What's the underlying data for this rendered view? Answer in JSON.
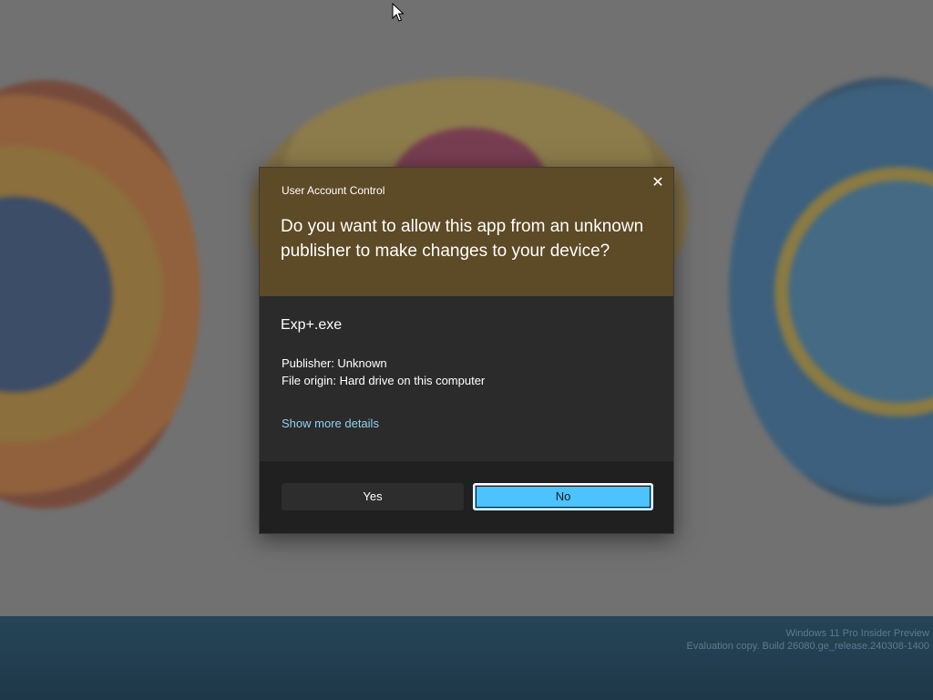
{
  "dialog": {
    "title": "User Account Control",
    "question": "Do you want to allow this app from an unknown publisher to make changes to your device?",
    "app_name": "Exp+.exe",
    "publisher": "Publisher: Unknown",
    "file_origin": "File origin: Hard drive on this computer",
    "show_details": "Show more details",
    "yes_label": "Yes",
    "no_label": "No",
    "close_glyph": "✕",
    "header_color": "#5d4a26",
    "accent_color": "#4cc2ff"
  },
  "watermark": {
    "line1": "Windows 11 Pro Insider Preview",
    "line2": "Evaluation copy. Build 26080.ge_release.240308-1400"
  },
  "icons": {
    "close": "close-icon",
    "cursor": "mouse-pointer-icon"
  }
}
